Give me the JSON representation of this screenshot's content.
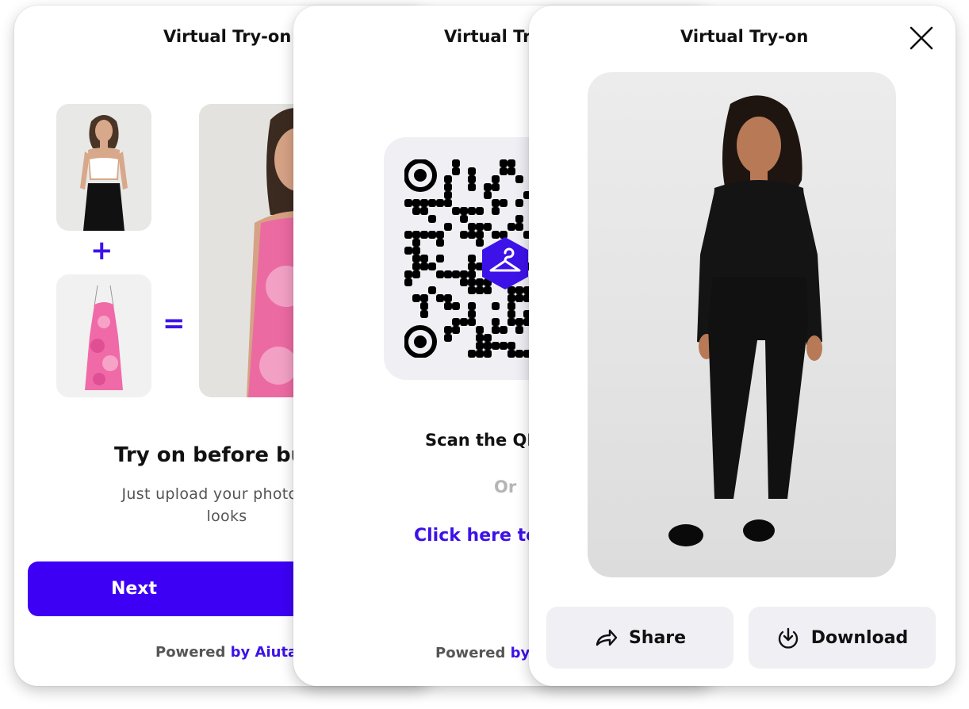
{
  "theme": {
    "accent": "#3d00f5",
    "link": "#3d12e8",
    "muted": "#555555",
    "button_bg": "#efeff4"
  },
  "card_intro": {
    "title": "Virtual Try-on",
    "plus_symbol": "+",
    "equals_symbol": "=",
    "heading": "Try on before buy",
    "subtitle_line1": "Just upload your photo and",
    "subtitle_line2": "looks",
    "next_label": "Next",
    "powered_prefix": "Powered",
    "powered_brand": "by Aiuta"
  },
  "card_qr": {
    "title": "Virtual Tr",
    "scan_text": "Scan the QR",
    "or_text": "Or",
    "link_text": "Click here to",
    "powered_prefix": "Powered",
    "powered_brand": "by"
  },
  "card_result": {
    "title": "Virtual Try-on",
    "share_label": "Share",
    "download_label": "Download"
  },
  "icons": [
    "close-icon",
    "share-icon",
    "download-icon",
    "hanger-icon",
    "qr-code"
  ]
}
